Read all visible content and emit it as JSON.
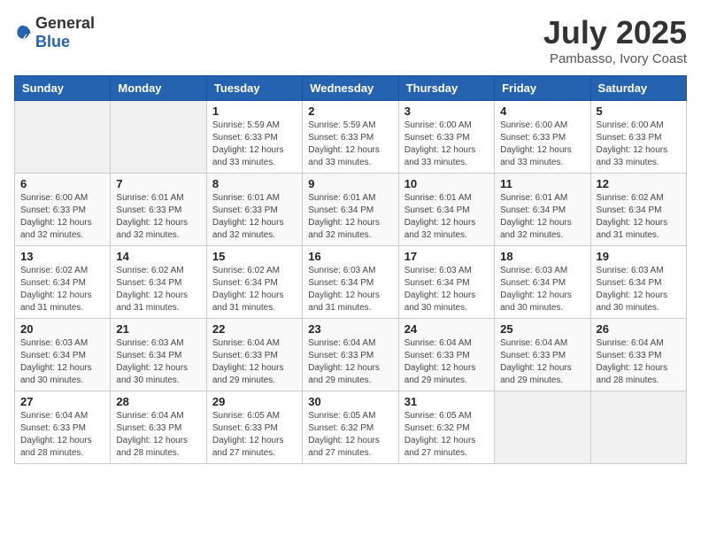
{
  "logo": {
    "text_general": "General",
    "text_blue": "Blue"
  },
  "header": {
    "month_year": "July 2025",
    "location": "Pambasso, Ivory Coast"
  },
  "weekdays": [
    "Sunday",
    "Monday",
    "Tuesday",
    "Wednesday",
    "Thursday",
    "Friday",
    "Saturday"
  ],
  "weeks": [
    [
      {
        "day": "",
        "sunrise": "",
        "sunset": "",
        "daylight": ""
      },
      {
        "day": "",
        "sunrise": "",
        "sunset": "",
        "daylight": ""
      },
      {
        "day": "1",
        "sunrise": "Sunrise: 5:59 AM",
        "sunset": "Sunset: 6:33 PM",
        "daylight": "Daylight: 12 hours and 33 minutes."
      },
      {
        "day": "2",
        "sunrise": "Sunrise: 5:59 AM",
        "sunset": "Sunset: 6:33 PM",
        "daylight": "Daylight: 12 hours and 33 minutes."
      },
      {
        "day": "3",
        "sunrise": "Sunrise: 6:00 AM",
        "sunset": "Sunset: 6:33 PM",
        "daylight": "Daylight: 12 hours and 33 minutes."
      },
      {
        "day": "4",
        "sunrise": "Sunrise: 6:00 AM",
        "sunset": "Sunset: 6:33 PM",
        "daylight": "Daylight: 12 hours and 33 minutes."
      },
      {
        "day": "5",
        "sunrise": "Sunrise: 6:00 AM",
        "sunset": "Sunset: 6:33 PM",
        "daylight": "Daylight: 12 hours and 33 minutes."
      }
    ],
    [
      {
        "day": "6",
        "sunrise": "Sunrise: 6:00 AM",
        "sunset": "Sunset: 6:33 PM",
        "daylight": "Daylight: 12 hours and 32 minutes."
      },
      {
        "day": "7",
        "sunrise": "Sunrise: 6:01 AM",
        "sunset": "Sunset: 6:33 PM",
        "daylight": "Daylight: 12 hours and 32 minutes."
      },
      {
        "day": "8",
        "sunrise": "Sunrise: 6:01 AM",
        "sunset": "Sunset: 6:33 PM",
        "daylight": "Daylight: 12 hours and 32 minutes."
      },
      {
        "day": "9",
        "sunrise": "Sunrise: 6:01 AM",
        "sunset": "Sunset: 6:34 PM",
        "daylight": "Daylight: 12 hours and 32 minutes."
      },
      {
        "day": "10",
        "sunrise": "Sunrise: 6:01 AM",
        "sunset": "Sunset: 6:34 PM",
        "daylight": "Daylight: 12 hours and 32 minutes."
      },
      {
        "day": "11",
        "sunrise": "Sunrise: 6:01 AM",
        "sunset": "Sunset: 6:34 PM",
        "daylight": "Daylight: 12 hours and 32 minutes."
      },
      {
        "day": "12",
        "sunrise": "Sunrise: 6:02 AM",
        "sunset": "Sunset: 6:34 PM",
        "daylight": "Daylight: 12 hours and 31 minutes."
      }
    ],
    [
      {
        "day": "13",
        "sunrise": "Sunrise: 6:02 AM",
        "sunset": "Sunset: 6:34 PM",
        "daylight": "Daylight: 12 hours and 31 minutes."
      },
      {
        "day": "14",
        "sunrise": "Sunrise: 6:02 AM",
        "sunset": "Sunset: 6:34 PM",
        "daylight": "Daylight: 12 hours and 31 minutes."
      },
      {
        "day": "15",
        "sunrise": "Sunrise: 6:02 AM",
        "sunset": "Sunset: 6:34 PM",
        "daylight": "Daylight: 12 hours and 31 minutes."
      },
      {
        "day": "16",
        "sunrise": "Sunrise: 6:03 AM",
        "sunset": "Sunset: 6:34 PM",
        "daylight": "Daylight: 12 hours and 31 minutes."
      },
      {
        "day": "17",
        "sunrise": "Sunrise: 6:03 AM",
        "sunset": "Sunset: 6:34 PM",
        "daylight": "Daylight: 12 hours and 30 minutes."
      },
      {
        "day": "18",
        "sunrise": "Sunrise: 6:03 AM",
        "sunset": "Sunset: 6:34 PM",
        "daylight": "Daylight: 12 hours and 30 minutes."
      },
      {
        "day": "19",
        "sunrise": "Sunrise: 6:03 AM",
        "sunset": "Sunset: 6:34 PM",
        "daylight": "Daylight: 12 hours and 30 minutes."
      }
    ],
    [
      {
        "day": "20",
        "sunrise": "Sunrise: 6:03 AM",
        "sunset": "Sunset: 6:34 PM",
        "daylight": "Daylight: 12 hours and 30 minutes."
      },
      {
        "day": "21",
        "sunrise": "Sunrise: 6:03 AM",
        "sunset": "Sunset: 6:34 PM",
        "daylight": "Daylight: 12 hours and 30 minutes."
      },
      {
        "day": "22",
        "sunrise": "Sunrise: 6:04 AM",
        "sunset": "Sunset: 6:33 PM",
        "daylight": "Daylight: 12 hours and 29 minutes."
      },
      {
        "day": "23",
        "sunrise": "Sunrise: 6:04 AM",
        "sunset": "Sunset: 6:33 PM",
        "daylight": "Daylight: 12 hours and 29 minutes."
      },
      {
        "day": "24",
        "sunrise": "Sunrise: 6:04 AM",
        "sunset": "Sunset: 6:33 PM",
        "daylight": "Daylight: 12 hours and 29 minutes."
      },
      {
        "day": "25",
        "sunrise": "Sunrise: 6:04 AM",
        "sunset": "Sunset: 6:33 PM",
        "daylight": "Daylight: 12 hours and 29 minutes."
      },
      {
        "day": "26",
        "sunrise": "Sunrise: 6:04 AM",
        "sunset": "Sunset: 6:33 PM",
        "daylight": "Daylight: 12 hours and 28 minutes."
      }
    ],
    [
      {
        "day": "27",
        "sunrise": "Sunrise: 6:04 AM",
        "sunset": "Sunset: 6:33 PM",
        "daylight": "Daylight: 12 hours and 28 minutes."
      },
      {
        "day": "28",
        "sunrise": "Sunrise: 6:04 AM",
        "sunset": "Sunset: 6:33 PM",
        "daylight": "Daylight: 12 hours and 28 minutes."
      },
      {
        "day": "29",
        "sunrise": "Sunrise: 6:05 AM",
        "sunset": "Sunset: 6:33 PM",
        "daylight": "Daylight: 12 hours and 27 minutes."
      },
      {
        "day": "30",
        "sunrise": "Sunrise: 6:05 AM",
        "sunset": "Sunset: 6:32 PM",
        "daylight": "Daylight: 12 hours and 27 minutes."
      },
      {
        "day": "31",
        "sunrise": "Sunrise: 6:05 AM",
        "sunset": "Sunset: 6:32 PM",
        "daylight": "Daylight: 12 hours and 27 minutes."
      },
      {
        "day": "",
        "sunrise": "",
        "sunset": "",
        "daylight": ""
      },
      {
        "day": "",
        "sunrise": "",
        "sunset": "",
        "daylight": ""
      }
    ]
  ]
}
